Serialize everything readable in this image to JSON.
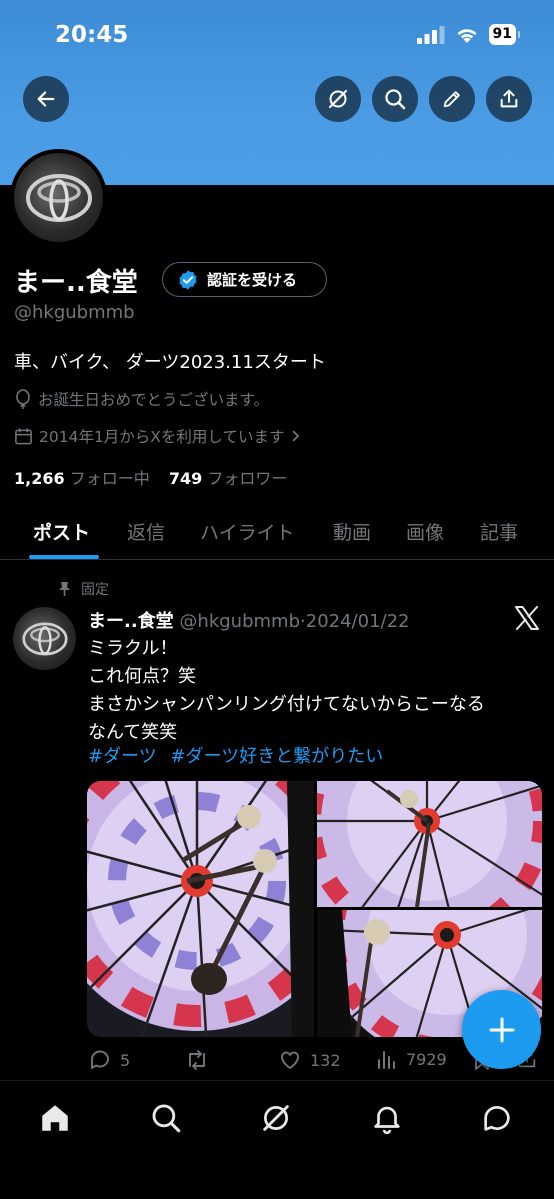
{
  "status": {
    "time": "20:45",
    "battery": "91"
  },
  "profile": {
    "name": "まー..食堂",
    "verify_label": "認証を受ける",
    "handle": "@hkgubmmb",
    "bio": "車、バイク、 ダーツ2023.11スタート",
    "birthday": "お誕生日おめでとうございます。",
    "joined": "2014年1月からXを利用しています",
    "following_count": "1,266",
    "following_label": "フォロー中",
    "followers_count": "749",
    "followers_label": "フォロワー"
  },
  "tabs": [
    "ポスト",
    "返信",
    "ハイライト",
    "動画",
    "画像",
    "記事"
  ],
  "post": {
    "pinned_label": "固定",
    "name": "まー..食堂",
    "handle": "@hkgubmmb",
    "sep": "·",
    "date": "2024/01/22",
    "lines": [
      "ミラクル！",
      "これ何点？笑",
      "まさかシャンパンリング付けてないからこーなる",
      "なんて笑笑"
    ],
    "hashtags": [
      "#ダーツ",
      "#ダーツ好きと繋がりたい"
    ],
    "replies": "5",
    "likes": "132",
    "views": "7929"
  },
  "colors": {
    "accent": "#1d9bf0",
    "banner": "#4a9be3",
    "muted": "#71767b"
  },
  "icons": [
    "back-arrow-icon",
    "grok-icon",
    "search-icon",
    "pencil-icon",
    "share-icon",
    "verified-badge-icon",
    "balloon-icon",
    "calendar-icon",
    "pin-icon",
    "x-logo-icon",
    "reply-icon",
    "repost-icon",
    "like-icon",
    "views-icon",
    "bookmark-icon",
    "plus-icon",
    "home-icon",
    "notifications-icon",
    "messages-icon"
  ]
}
